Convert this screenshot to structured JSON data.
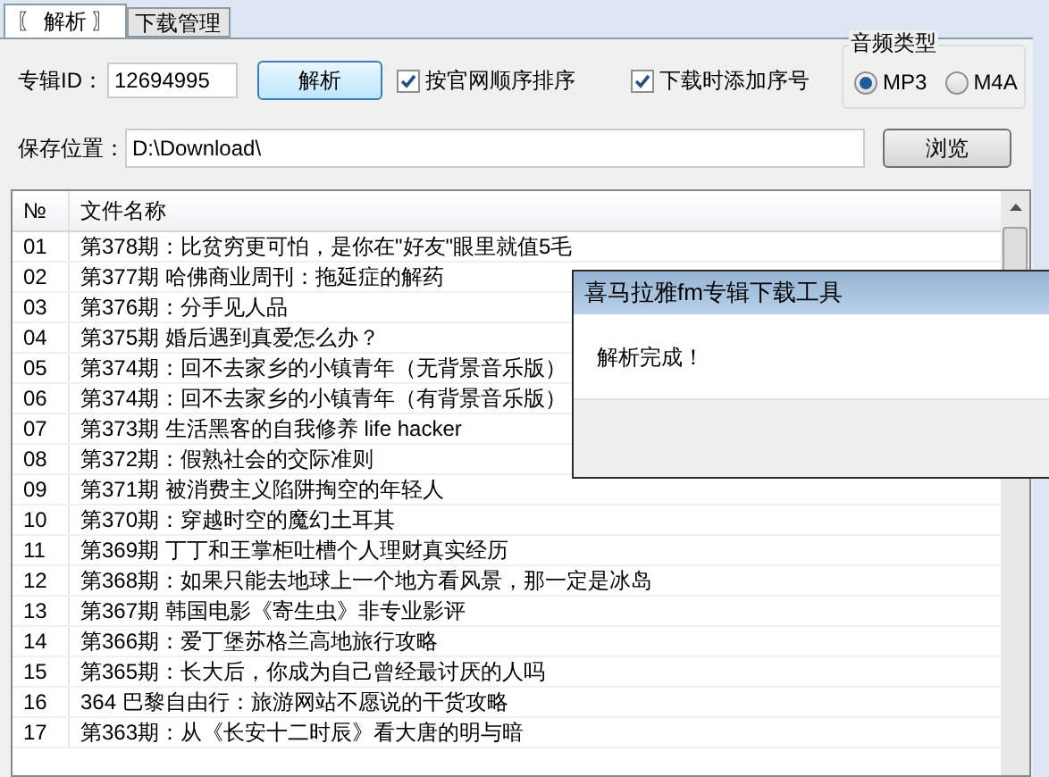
{
  "tabs": [
    {
      "label": "〖 解析 〗",
      "selected": true
    },
    {
      "label": "下载管理",
      "selected": false
    }
  ],
  "album": {
    "label": "专辑ID：",
    "value": "12694995"
  },
  "parse_button": "解析",
  "options": [
    {
      "label": "按官网顺序排序",
      "checked": true
    },
    {
      "label": "下载时添加序号",
      "checked": true
    }
  ],
  "audio_type": {
    "title": "音频类型",
    "options": [
      {
        "label": "MP3",
        "selected": true
      },
      {
        "label": "M4A",
        "selected": false
      }
    ]
  },
  "save_path": {
    "label": "保存位置：",
    "value": "D:\\Download\\"
  },
  "browse_button": "浏览",
  "table": {
    "columns": [
      "№",
      "文件名称"
    ],
    "rows": [
      [
        "01",
        "第378期：比贫穷更可怕，是你在\"好友\"眼里就值5毛"
      ],
      [
        "02",
        "第377期 哈佛商业周刊：拖延症的解药"
      ],
      [
        "03",
        "第376期：分手见人品"
      ],
      [
        "04",
        "第375期 婚后遇到真爱怎么办？"
      ],
      [
        "05",
        "第374期：回不去家乡的小镇青年（无背景音乐版）"
      ],
      [
        "06",
        "第374期：回不去家乡的小镇青年（有背景音乐版）"
      ],
      [
        "07",
        "第373期 生活黑客的自我修养 life hacker"
      ],
      [
        "08",
        "第372期：假熟社会的交际准则"
      ],
      [
        "09",
        "第371期 被消费主义陷阱掏空的年轻人"
      ],
      [
        "10",
        "第370期：穿越时空的魔幻土耳其"
      ],
      [
        "11",
        "第369期 丁丁和王掌柜吐槽个人理财真实经历"
      ],
      [
        "12",
        "第368期：如果只能去地球上一个地方看风景，那一定是冰岛"
      ],
      [
        "13",
        "第367期 韩国电影《寄生虫》非专业影评"
      ],
      [
        "14",
        "第366期：爱丁堡苏格兰高地旅行攻略"
      ],
      [
        "15",
        "第365期：长大后，你成为自己曾经最讨厌的人吗"
      ],
      [
        "16",
        "364 巴黎自由行：旅游网站不愿说的干货攻略"
      ],
      [
        "17",
        "第363期：从《长安十二时辰》看大唐的明与暗"
      ]
    ]
  },
  "dialog": {
    "title": "喜马拉雅fm专辑下载工具",
    "message": "解析完成！"
  }
}
